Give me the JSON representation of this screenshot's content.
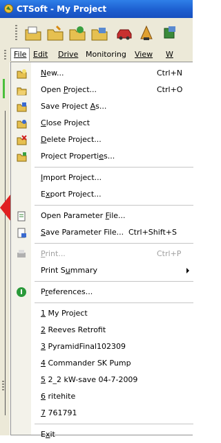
{
  "window": {
    "title": "CTSoft - My Project"
  },
  "toolbar": {
    "buttons": [
      "open-folder-icon",
      "folder-icon",
      "save-icon",
      "folder-open-icon",
      "car-icon",
      "tools-icon",
      "component-icon"
    ]
  },
  "menubar": {
    "items": [
      {
        "label": "File",
        "mnemonic_index": 0
      },
      {
        "label": "Edit",
        "mnemonic_index": 0
      },
      {
        "label": "Drive",
        "mnemonic_index": 0
      },
      {
        "label": "Monitoring",
        "mnemonic_index": -1
      },
      {
        "label": "View",
        "mnemonic_index": 0
      },
      {
        "label": "W",
        "mnemonic_index": 0
      }
    ]
  },
  "file_menu": {
    "items": [
      {
        "label": "New...",
        "mn": 0,
        "shortcut": "Ctrl+N",
        "icon": "new-project-icon"
      },
      {
        "label": "Open Project...",
        "mn": 5,
        "shortcut": "Ctrl+O",
        "icon": "open-project-icon"
      },
      {
        "label": "Save Project As...",
        "mn": 13,
        "shortcut": "",
        "icon": "save-project-icon"
      },
      {
        "label": "Close Project",
        "mn": 0,
        "shortcut": "",
        "icon": "close-project-icon"
      },
      {
        "label": "Delete Project...",
        "mn": 0,
        "shortcut": "",
        "icon": "delete-project-icon"
      },
      {
        "label": "Project Properties...",
        "mn": 16,
        "shortcut": "",
        "icon": "project-properties-icon"
      },
      {
        "separator": true
      },
      {
        "label": "Import Project...",
        "mn": 0,
        "shortcut": "",
        "icon": ""
      },
      {
        "label": "Export Project...",
        "mn": 1,
        "shortcut": "",
        "icon": ""
      },
      {
        "separator": true
      },
      {
        "label": "Open Parameter File...",
        "mn": 15,
        "shortcut": "",
        "icon": "open-parameter-file-icon"
      },
      {
        "label": "Save Parameter File...",
        "mn": 0,
        "shortcut": "Ctrl+Shift+S",
        "icon": "save-parameter-file-icon"
      },
      {
        "separator": true
      },
      {
        "label": "Print...",
        "mn": 0,
        "shortcut": "Ctrl+P",
        "icon": "printer-icon",
        "disabled": true
      },
      {
        "label": "Print Summary",
        "mn": 7,
        "shortcut": "",
        "icon": "",
        "submenu": true
      },
      {
        "separator": true
      },
      {
        "label": "Preferences...",
        "mn": 1,
        "shortcut": "",
        "icon": "preferences-icon"
      },
      {
        "separator": true
      },
      {
        "label": "1 My Project",
        "mn": 0,
        "shortcut": "",
        "icon": ""
      },
      {
        "label": "2 Reeves Retrofit",
        "mn": 0,
        "shortcut": "",
        "icon": ""
      },
      {
        "label": "3 PyramidFinal102309",
        "mn": 0,
        "shortcut": "",
        "icon": ""
      },
      {
        "label": "4 Commander SK Pump",
        "mn": 0,
        "shortcut": "",
        "icon": ""
      },
      {
        "label": "5 2_2 kW-save 04-7-2009",
        "mn": 0,
        "shortcut": "",
        "icon": ""
      },
      {
        "label": "6 ritehite",
        "mn": 0,
        "shortcut": "",
        "icon": ""
      },
      {
        "label": "7 761791",
        "mn": 0,
        "shortcut": "",
        "icon": ""
      },
      {
        "separator": true
      },
      {
        "label": "Exit",
        "mn": 1,
        "shortcut": "",
        "icon": ""
      }
    ]
  },
  "colors": {
    "title_bar": "#1d5fd0",
    "accent_arrow": "#e02020",
    "disabled_text": "#a0a0a0"
  }
}
